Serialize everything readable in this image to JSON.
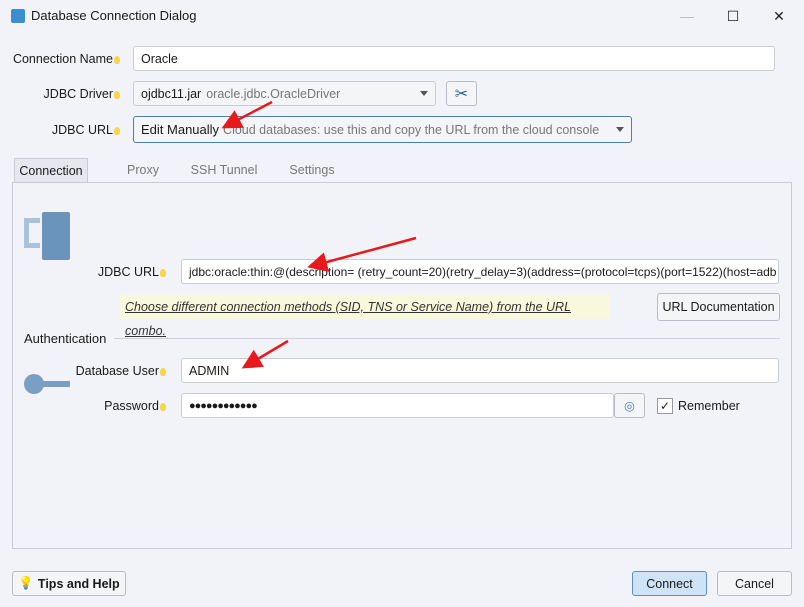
{
  "window": {
    "title": "Database Connection Dialog"
  },
  "form": {
    "connection_name_label": "Connection Name",
    "connection_name": "Oracle",
    "driver_label": "JDBC Driver",
    "driver_jar": "ojdbc11.jar",
    "driver_class": "oracle.jdbc.OracleDriver",
    "url_combo_label": "JDBC URL",
    "url_mode": "Edit Manually",
    "url_mode_hint": "Cloud databases: use this and copy the URL from the cloud console"
  },
  "tabs": [
    {
      "label": "Connection",
      "active": true
    },
    {
      "label": "Proxy"
    },
    {
      "label": "SSH Tunnel"
    },
    {
      "label": "Settings"
    }
  ],
  "connection": {
    "url_label": "JDBC URL",
    "url": "jdbc:oracle:thin:@(description= (retry_count=20)(retry_delay=3)(address=(protocol=tcps)(port=1522)(host=adb",
    "hint": "Choose different connection methods (SID, TNS or Service Name) from the URL combo.",
    "url_doc_button": "URL Documentation",
    "auth_heading": "Authentication",
    "user_label": "Database User",
    "user": "ADMIN",
    "password_label": "Password",
    "password": "●●●●●●●●●●●●",
    "remember_label": "Remember",
    "remember": true
  },
  "footer": {
    "tips": "Tips and Help",
    "connect": "Connect",
    "cancel": "Cancel"
  },
  "colors": {
    "accent": "#cfe3f7",
    "arrow": "#e8191a"
  }
}
